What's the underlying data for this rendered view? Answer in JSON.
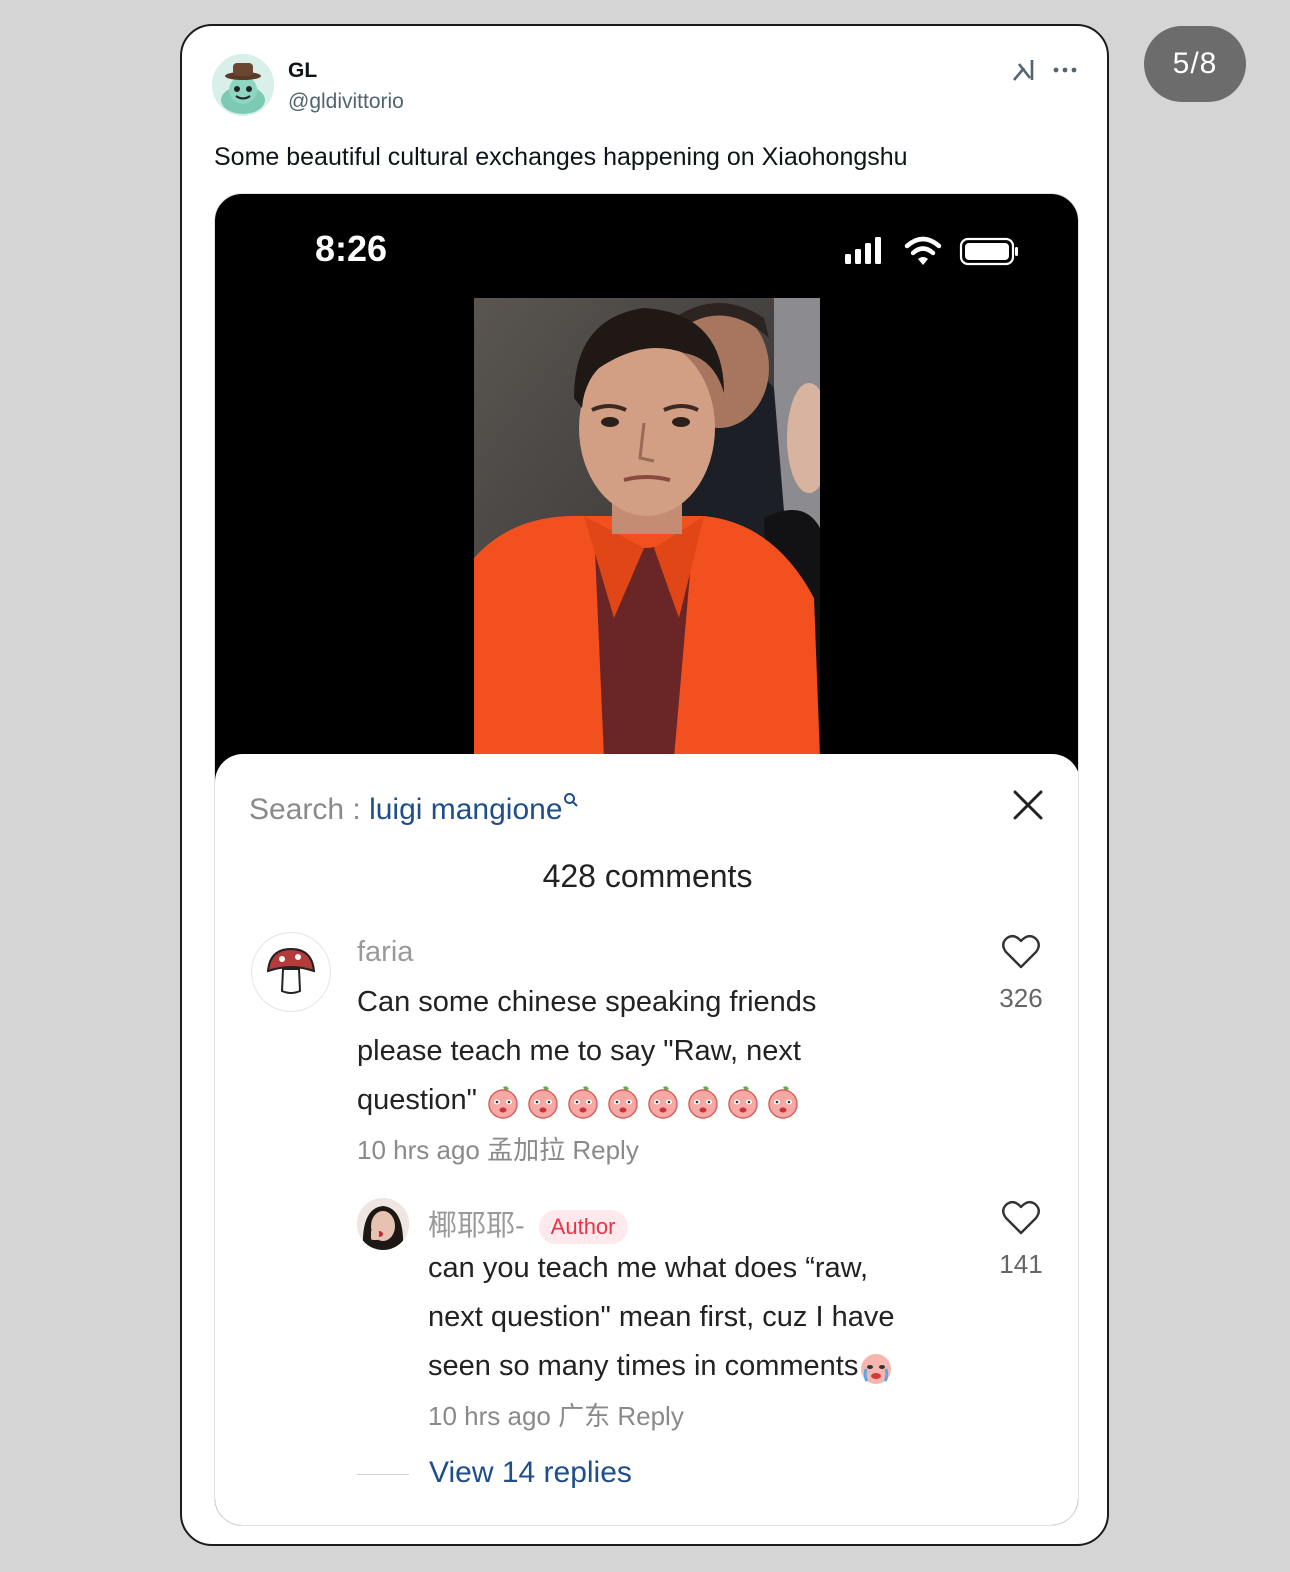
{
  "pager": {
    "label": "5/8"
  },
  "tweet": {
    "display_name": "GL",
    "handle": "@gldivittorio",
    "text": "Some beautiful cultural exchanges happening on Xiaohongshu"
  },
  "phone": {
    "time": "8:26",
    "status_icons": [
      "signal-icon",
      "wifi-icon",
      "battery-icon"
    ]
  },
  "sheet": {
    "search_label": "Search : ",
    "search_query": "luigi mangione",
    "comments_count": "428 comments",
    "view_replies": "View 14 replies"
  },
  "comments": [
    {
      "user": "faria",
      "text_lines": [
        "Can some chinese speaking friends",
        "please teach me to say \"Raw, next",
        "question\""
      ],
      "emoji_count": 8,
      "time": "10 hrs ago",
      "location": "孟加拉",
      "reply": "Reply",
      "likes": "326"
    },
    {
      "user": "椰耶耶-",
      "badge": "Author",
      "text_lines": [
        "can you teach me what does “raw,",
        "next question\" mean first, cuz I have",
        "seen so many times in comments"
      ],
      "time": "10 hrs ago",
      "location": "广东",
      "reply": "Reply",
      "likes": "141"
    }
  ],
  "colors": {
    "accent_link": "#1f4e8c",
    "author_badge": "#e8344a",
    "jumpsuit": "#f2501f"
  }
}
